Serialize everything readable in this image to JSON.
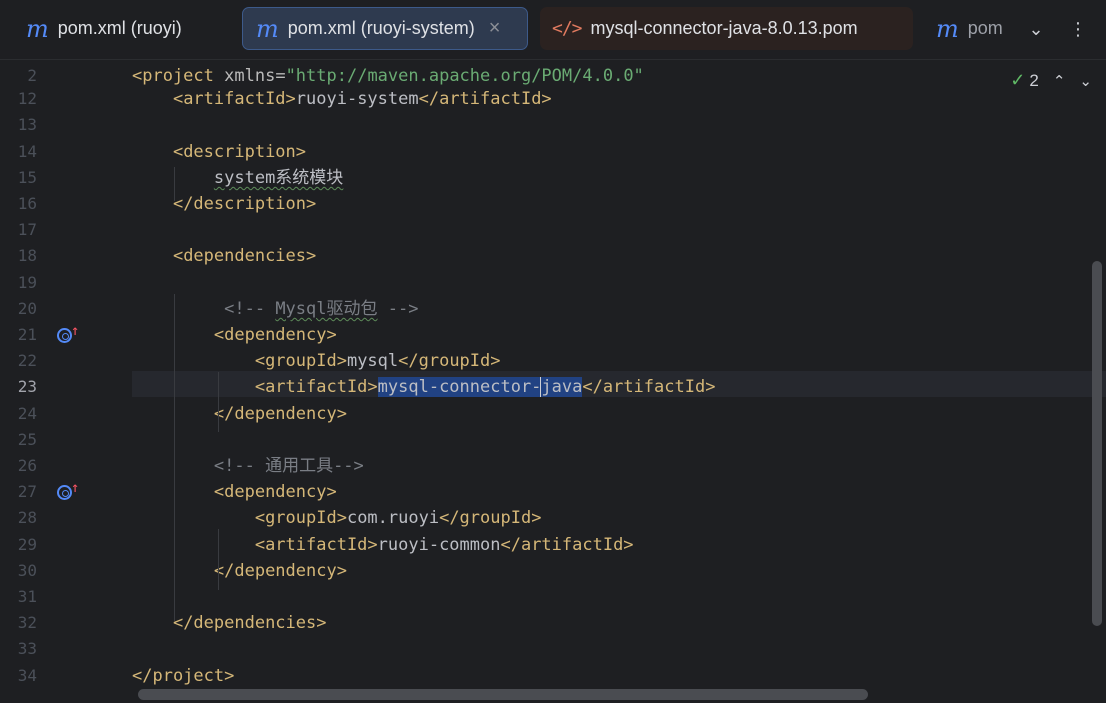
{
  "tabs": [
    {
      "icon": "m",
      "label": "pom.xml (ruoyi)",
      "active": false
    },
    {
      "icon": "m",
      "label": "pom.xml (ruoyi-system)",
      "active": true,
      "close": "×"
    },
    {
      "icon": "</>",
      "label": "mysql-connector-java-8.0.13.pom",
      "active": false
    },
    {
      "icon": "m",
      "label": "pom",
      "active": false
    }
  ],
  "tabbar": {
    "dropdown_glyph": "⌄",
    "more_glyph": "⋮"
  },
  "inspections": {
    "check_glyph": "✓",
    "count": "2",
    "up_glyph": "⌃",
    "down_glyph": "⌄"
  },
  "editor": {
    "sticky_line": {
      "number": "2",
      "tag_open": "<project ",
      "attr": "xmlns",
      "eq": "=",
      "value": "\"http://maven.apache.org/POM/4.0.0\""
    },
    "lines": [
      {
        "number": "12",
        "indent": "    ",
        "open": "<artifactId>",
        "text": "ruoyi-system",
        "close": "</artifactId>"
      },
      {
        "number": "13"
      },
      {
        "number": "14",
        "indent": "    ",
        "open": "<description>"
      },
      {
        "number": "15",
        "indent": "        ",
        "text": "system系统模块"
      },
      {
        "number": "16",
        "indent": "    ",
        "close": "</description>"
      },
      {
        "number": "17"
      },
      {
        "number": "18",
        "indent": "    ",
        "open": "<dependencies>"
      },
      {
        "number": "19"
      },
      {
        "number": "20",
        "indent": "         ",
        "comment_open": "<!-- ",
        "comment_word": "Mysql驱动包",
        "comment_close": " -->"
      },
      {
        "number": "21",
        "indent": "        ",
        "open": "<dependency>"
      },
      {
        "number": "22",
        "indent": "            ",
        "open": "<groupId>",
        "text": "mysql",
        "close": "</groupId>"
      },
      {
        "number": "23",
        "indent": "            ",
        "open": "<artifactId>",
        "sel_before_caret": "mysql-connector-",
        "sel_after_caret": "java",
        "close": "</artifactId>"
      },
      {
        "number": "24",
        "indent": "        ",
        "close": "</dependency>"
      },
      {
        "number": "25"
      },
      {
        "number": "26",
        "indent": "        ",
        "comment": "<!-- 通用工具-->"
      },
      {
        "number": "27",
        "indent": "        ",
        "open": "<dependency>"
      },
      {
        "number": "28",
        "indent": "            ",
        "open": "<groupId>",
        "text": "com.ruoyi",
        "close": "</groupId>"
      },
      {
        "number": "29",
        "indent": "            ",
        "open": "<artifactId>",
        "text": "ruoyi-common",
        "close": "</artifactId>"
      },
      {
        "number": "30",
        "indent": "        ",
        "close": "</dependency>"
      },
      {
        "number": "31"
      },
      {
        "number": "32",
        "indent": "    ",
        "close": "</dependencies>"
      },
      {
        "number": "33"
      },
      {
        "number": "34",
        "close": "</project>"
      }
    ],
    "current_line": "23",
    "gutter_icon_lines": [
      "21",
      "27"
    ],
    "gutter_arrow": "↑"
  }
}
